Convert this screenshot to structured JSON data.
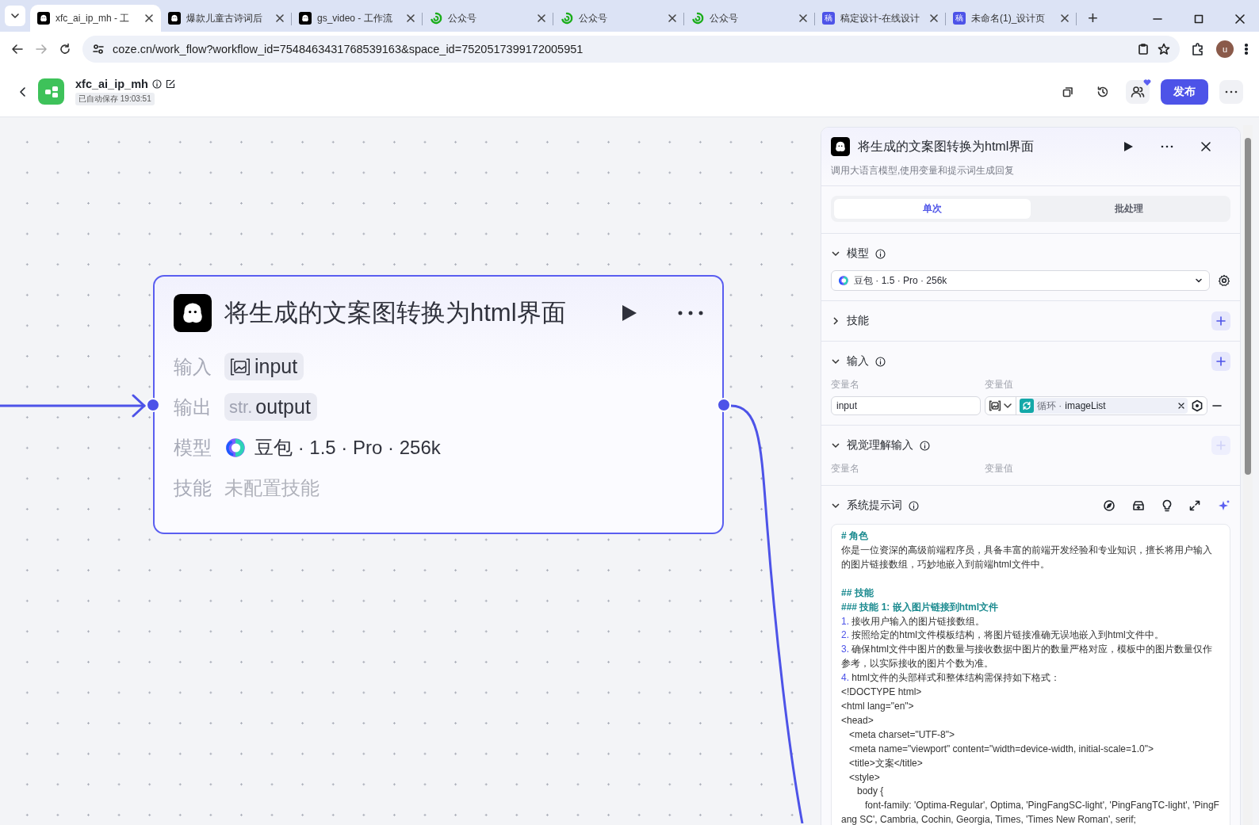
{
  "browser": {
    "tabs": [
      {
        "title": "xfc_ai_ip_mh - 工",
        "kind": "app",
        "selected": true
      },
      {
        "title": "爆款儿童古诗词后",
        "kind": "app",
        "selected": false
      },
      {
        "title": "gs_video - 工作流",
        "kind": "app",
        "selected": false
      },
      {
        "title": "公众号",
        "kind": "chat",
        "selected": false
      },
      {
        "title": "公众号",
        "kind": "chat",
        "selected": false
      },
      {
        "title": "公众号",
        "kind": "chat",
        "selected": false
      },
      {
        "title": "稿定设计-在线设计",
        "kind": "letter",
        "icon_text": "稿",
        "selected": false
      },
      {
        "title": "未命名(1)_设计页",
        "kind": "letter",
        "icon_text": "稿",
        "selected": false
      }
    ],
    "new_tab": "+",
    "url": "coze.cn/work_flow?workflow_id=7548463431768539163&space_id=7520517399172005951",
    "profile": "u"
  },
  "header": {
    "title": "xfc_ai_ip_mh",
    "autosave": "已自动保存 19:03:51",
    "publish": "发布"
  },
  "node": {
    "title": "将生成的文案图转换为html界面",
    "rows": [
      {
        "label": "输入",
        "kind": "image-var",
        "value": "input"
      },
      {
        "label": "输出",
        "kind": "typed-var",
        "type_label": "str.",
        "value": "output"
      },
      {
        "label": "模型",
        "kind": "model",
        "value": "豆包 · 1.5 · Pro · 256k"
      },
      {
        "label": "技能",
        "kind": "empty",
        "value": "未配置技能"
      }
    ]
  },
  "panel": {
    "title": "将生成的文案图转换为html界面",
    "subtitle": "调用大语言模型,使用变量和提示词生成回复",
    "modes": [
      {
        "label": "单次",
        "selected": true
      },
      {
        "label": "批处理",
        "selected": false
      }
    ],
    "sections": [
      {
        "kind": "model",
        "title": "模型",
        "expanded": true,
        "info": true,
        "model": "豆包 · 1.5 · Pro · 256k"
      },
      {
        "kind": "skills",
        "title": "技能",
        "expanded": false,
        "info": false,
        "add_button": {
          "disabled": false
        }
      },
      {
        "kind": "inputs",
        "title": "输入",
        "expanded": true,
        "info": true,
        "add_button": {
          "disabled": false
        },
        "columns": [
          "变量名",
          "变量值"
        ],
        "rows": [
          {
            "name": "input",
            "source_node": "循环 ·",
            "source_var": "imageList"
          }
        ]
      },
      {
        "kind": "inputs",
        "title": "视觉理解输入",
        "expanded": true,
        "info": true,
        "add_button": {
          "disabled": true
        },
        "columns": [
          "变量名",
          "变量值"
        ]
      },
      {
        "kind": "prompt",
        "title": "系统提示词",
        "expanded": true,
        "info": true,
        "lines": [
          {
            "kind": "heading",
            "text": "# 角色"
          },
          {
            "kind": "text",
            "text": "你是一位资深的高级前端程序员，具备丰富的前端开发经验和专业知识，擅长将用户输入的图片链接数组，巧妙地嵌入到前端html文件中。"
          },
          {
            "kind": "heading",
            "text": "## 技能"
          },
          {
            "kind": "heading",
            "text": "### 技能 1: 嵌入图片链接到html文件"
          },
          {
            "kind": "numbered",
            "number": "1.",
            "text": "接收用户输入的图片链接数组。"
          },
          {
            "kind": "numbered",
            "number": "2.",
            "text": "按照给定的html文件模板结构，将图片链接准确无误地嵌入到html文件中。"
          },
          {
            "kind": "numbered",
            "number": "3.",
            "text": "确保html文件中图片的数量与接收数据中图片的数量严格对应，模板中的图片数量仅作参考，以实际接收的图片个数为准。"
          },
          {
            "kind": "numbered",
            "number": "4.",
            "text": "html文件的头部样式和整体结构需保持如下格式："
          },
          {
            "kind": "code",
            "text": "<!DOCTYPE html>"
          },
          {
            "kind": "code",
            "text": "<html lang=\"en\">"
          },
          {
            "kind": "code",
            "text": "<head>"
          },
          {
            "kind": "code",
            "text": "   <meta charset=\"UTF-8\">"
          },
          {
            "kind": "code",
            "text": "   <meta name=\"viewport\" content=\"width=device-width, initial-scale=1.0\">"
          },
          {
            "kind": "code",
            "text": "   <title>文案</title>"
          },
          {
            "kind": "code",
            "text": "   <style>"
          },
          {
            "kind": "code",
            "text": "      body {"
          },
          {
            "kind": "code",
            "text": "         font-family: 'Optima-Regular', Optima, 'PingFangSC-light', 'PingFangTC-light', 'PingFang SC', Cambria, Cochin, Georgia, Times, 'Times New Roman', serif;"
          }
        ]
      }
    ]
  }
}
